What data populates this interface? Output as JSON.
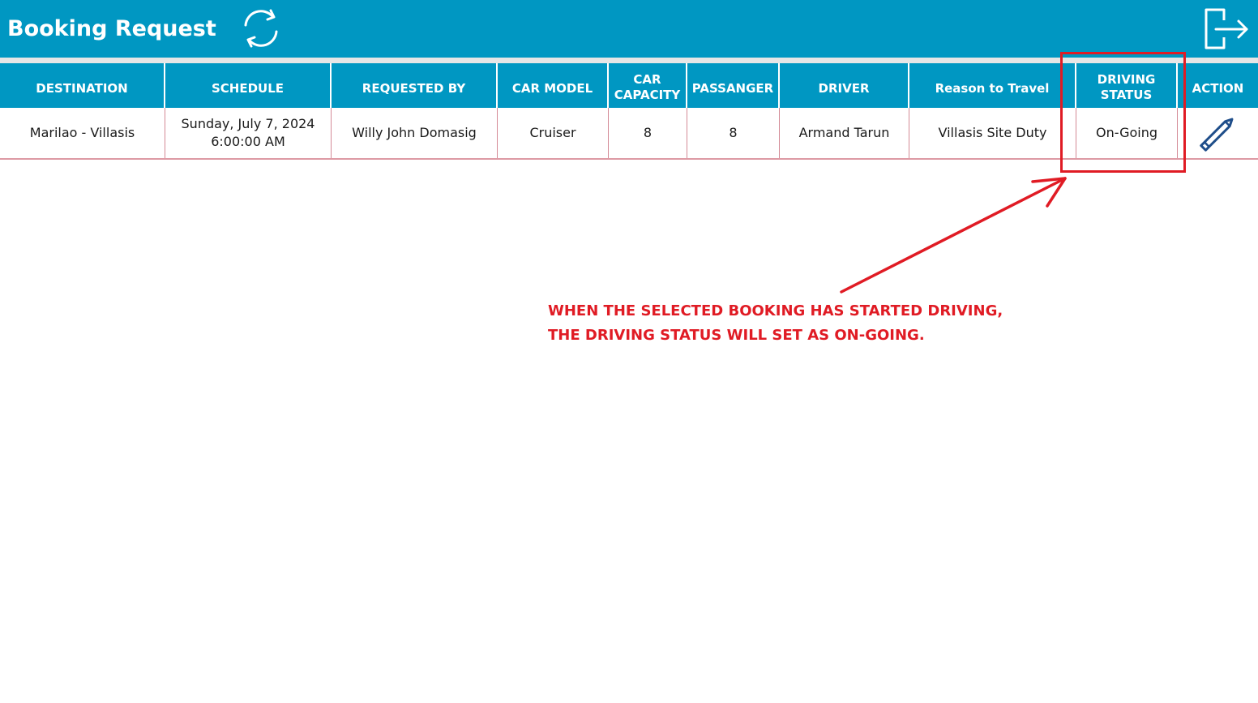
{
  "header": {
    "title": "Booking Request",
    "refresh_icon": "refresh-icon",
    "logout_icon": "logout-icon",
    "color": "#0097c2"
  },
  "table": {
    "columns": [
      {
        "line1": "DESTINATION",
        "line2": ""
      },
      {
        "line1": "SCHEDULE",
        "line2": ""
      },
      {
        "line1": "REQUESTED BY",
        "line2": ""
      },
      {
        "line1": "CAR MODEL",
        "line2": ""
      },
      {
        "line1": "CAR",
        "line2": "CAPACITY"
      },
      {
        "line1": "PASSANGER",
        "line2": ""
      },
      {
        "line1": "DRIVER",
        "line2": ""
      },
      {
        "line1": "Reason to Travel",
        "line2": ""
      },
      {
        "line1": "DRIVING",
        "line2": "STATUS"
      },
      {
        "line1": "ACTION",
        "line2": ""
      }
    ],
    "rows": [
      {
        "destination": "Marilao - Villasis",
        "schedule_date": "Sunday, July 7, 2024",
        "schedule_time": "6:00:00 AM",
        "requested_by": "Willy John Domasig",
        "car_model": "Cruiser",
        "car_capacity": "8",
        "passanger": "8",
        "driver": "Armand Tarun",
        "reason": "Villasis Site Duty",
        "driving_status": "On-Going",
        "action_icon": "pencil-icon"
      }
    ]
  },
  "annotation": {
    "line1": "WHEN THE SELECTED BOOKING HAS STARTED DRIVING,",
    "line2": "THE DRIVING STATUS WILL SET AS ON-GOING.",
    "color": "#e01b24"
  }
}
